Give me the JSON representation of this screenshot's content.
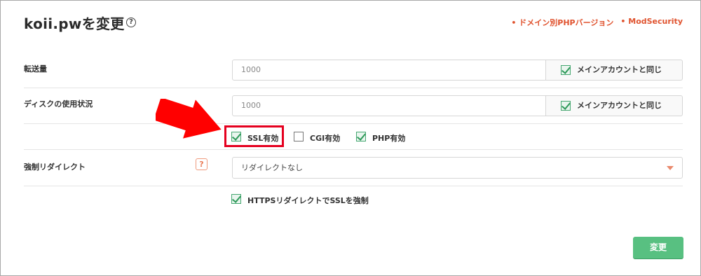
{
  "header": {
    "title": "koii.pwを変更",
    "help_icon_glyph": "?",
    "links": [
      "• ドメイン別PHPバージョン",
      "• ModSecurity"
    ]
  },
  "form": {
    "transfer": {
      "label": "転送量",
      "value": "1000",
      "same_as_main_label": "メインアカウントと同じ",
      "same_as_main_checked": true
    },
    "disk": {
      "label": "ディスクの使用状況",
      "value": "1000",
      "same_as_main_label": "メインアカウントと同じ",
      "same_as_main_checked": true
    },
    "features": [
      {
        "label": "SSL有効",
        "checked": true
      },
      {
        "label": "CGI有効",
        "checked": false
      },
      {
        "label": "PHP有効",
        "checked": true
      }
    ],
    "force_redirect": {
      "label": "強制リダイレクト",
      "help_glyph": "?",
      "selected": "リダイレクトなし"
    },
    "https_force": {
      "label": "HTTPSリダイレクトでSSLを強制",
      "checked": true
    },
    "submit_label": "変更"
  },
  "colors": {
    "accent_orange": "#e0532f",
    "submit_green": "#58c081",
    "highlight_red": "#e5001f",
    "arrow_red": "#ff0000"
  }
}
